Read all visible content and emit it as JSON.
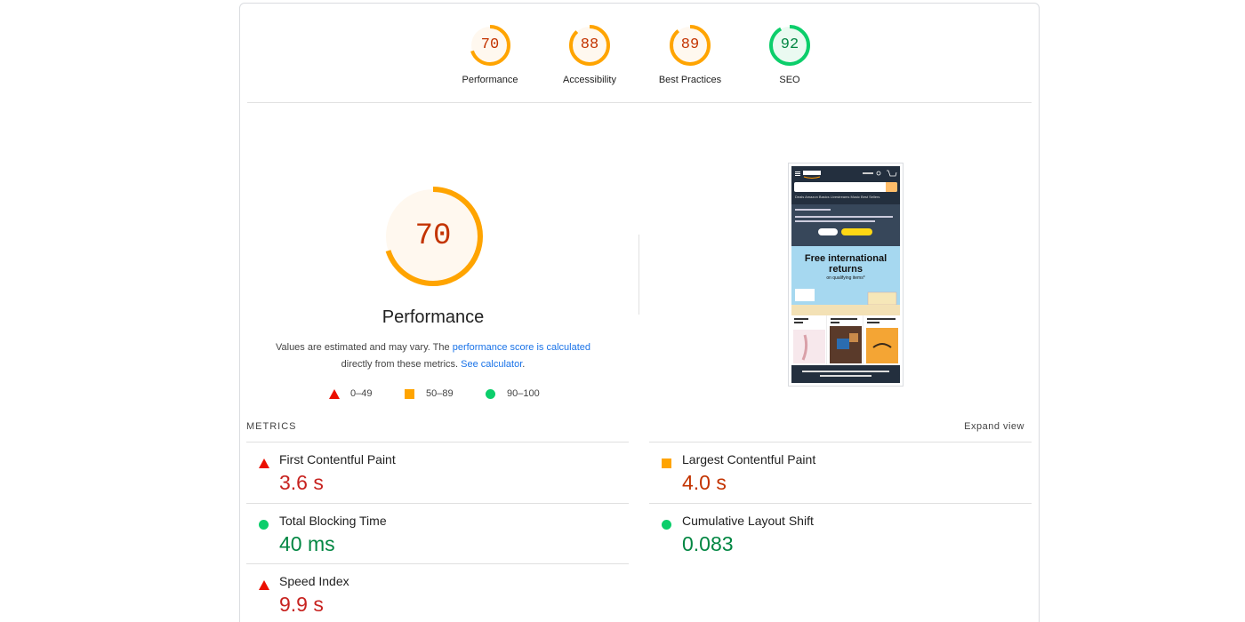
{
  "categories": [
    {
      "score": "70",
      "label": "Performance",
      "value": 70,
      "color": "#ffa400",
      "text_color": "#c33300",
      "fill": "#fff8ef"
    },
    {
      "score": "88",
      "label": "Accessibility",
      "value": 88,
      "color": "#ffa400",
      "text_color": "#c33300",
      "fill": "#fff8ef"
    },
    {
      "score": "89",
      "label": "Best Practices",
      "value": 89,
      "color": "#ffa400",
      "text_color": "#c33300",
      "fill": "#fff8ef"
    },
    {
      "score": "92",
      "label": "SEO",
      "value": 92,
      "color": "#0cce6b",
      "text_color": "#018642",
      "fill": "#eafaf1"
    }
  ],
  "main": {
    "score": "70",
    "value": 70,
    "title": "Performance",
    "note_prefix": "Values are estimated and may vary. The ",
    "note_link1": "performance score is calculated",
    "note_middle": " directly from these metrics. ",
    "note_link2": "See calculator",
    "note_suffix": "."
  },
  "legend": {
    "fail": "0–49",
    "average": "50–89",
    "pass": "90–100"
  },
  "screenshot": {
    "banner_title": "Free international returns",
    "banner_sub": "on qualifying items*",
    "nav_text": "Deals  Amazon Basics  Livestreams  Music  Best Sellers"
  },
  "metrics": {
    "heading": "METRICS",
    "expand_label": "Expand view",
    "items": [
      {
        "label": "First Contentful Paint",
        "value": "3.6 s",
        "rating": "fail"
      },
      {
        "label": "Largest Contentful Paint",
        "value": "4.0 s",
        "rating": "average"
      },
      {
        "label": "Total Blocking Time",
        "value": "40 ms",
        "rating": "pass"
      },
      {
        "label": "Cumulative Layout Shift",
        "value": "0.083",
        "rating": "pass"
      },
      {
        "label": "Speed Index",
        "value": "9.9 s",
        "rating": "fail"
      }
    ]
  }
}
